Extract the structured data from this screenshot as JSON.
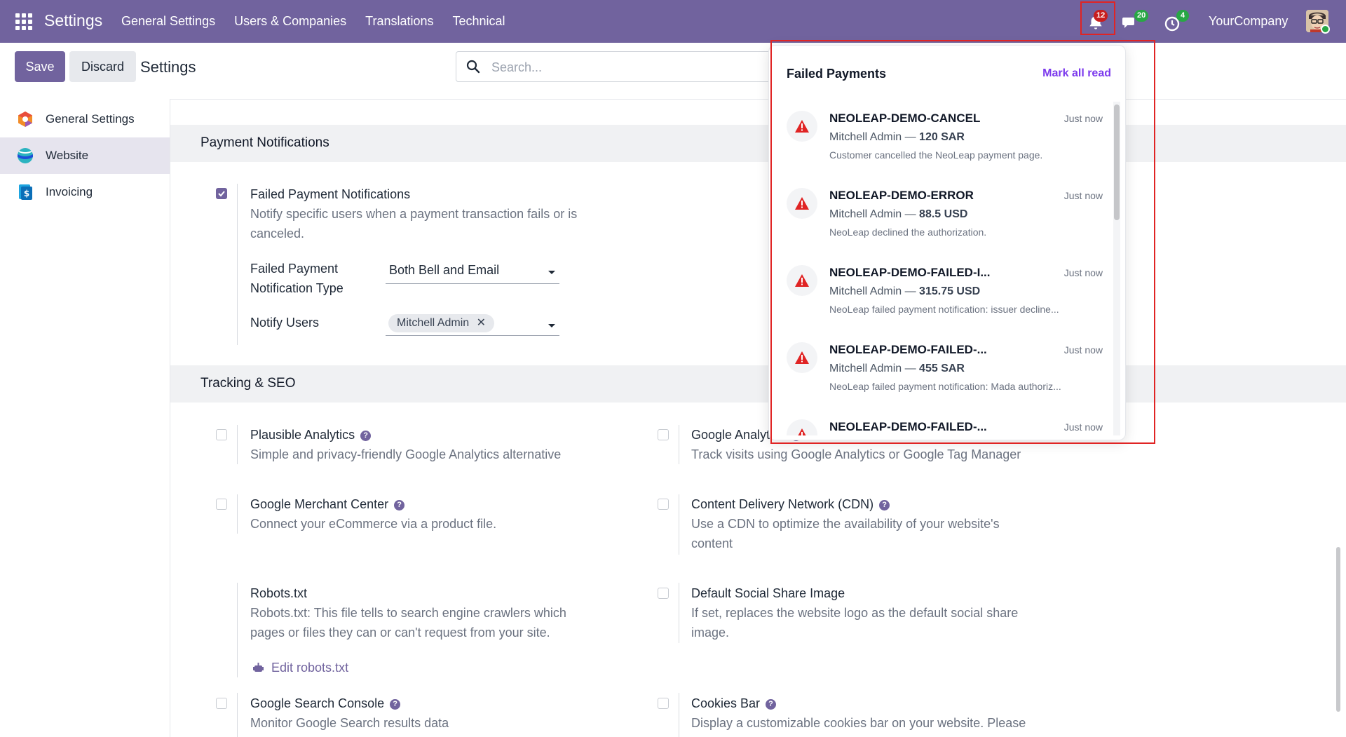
{
  "navbar": {
    "brand": "Settings",
    "menu": [
      "General Settings",
      "Users & Companies",
      "Translations",
      "Technical"
    ],
    "notifications_count": "12",
    "messages_count": "20",
    "activities_count": "4",
    "company": "YourCompany",
    "accent_color": "#71639e"
  },
  "control_panel": {
    "save_label": "Save",
    "discard_label": "Discard",
    "title": "Settings",
    "search_placeholder": "Search..."
  },
  "sidebar": {
    "items": [
      {
        "label": "General Settings",
        "icon": "odoo-settings-icon",
        "active": false
      },
      {
        "label": "Website",
        "icon": "website-app-icon",
        "active": true
      },
      {
        "label": "Invoicing",
        "icon": "invoicing-app-icon",
        "active": false
      }
    ]
  },
  "payment_notifications": {
    "heading": "Payment Notifications",
    "failed_title": "Failed Payment Notifications",
    "failed_desc_line1": "Notify specific users when a payment transaction fails or is",
    "failed_desc_line2": "canceled.",
    "type_label_line1": "Failed Payment",
    "type_label_line2": "Notification Type",
    "type_value": "Both Bell and Email",
    "users_label": "Notify Users",
    "users_tag": "Mitchell Admin"
  },
  "tracking_seo": {
    "heading": "Tracking & SEO",
    "settings": [
      {
        "title": "Plausible Analytics",
        "desc": [
          "Simple and privacy-friendly Google Analytics alternative"
        ]
      },
      {
        "title": "Google Analytics",
        "desc": [
          "Track visits using Google Analytics or Google Tag Manager"
        ]
      },
      {
        "title": "Google Merchant Center",
        "desc": [
          "Connect your eCommerce via a product file."
        ]
      },
      {
        "title": "Content Delivery Network (CDN)",
        "desc": [
          "Use a CDN to optimize the availability of your website's",
          "content"
        ]
      },
      {
        "title": "Robots.txt",
        "desc": [
          "Robots.txt: This file tells to search engine crawlers which",
          "pages or files they can or can't request from your site."
        ],
        "link": "Edit robots.txt"
      },
      {
        "title": "Default Social Share Image",
        "desc": [
          "If set, replaces the website logo as the default social share",
          "image."
        ]
      },
      {
        "title": "Google Search Console",
        "desc": [
          "Monitor Google Search results data"
        ]
      },
      {
        "title": "Cookies Bar",
        "desc": [
          "Display a customizable cookies bar on your website. Please"
        ]
      }
    ]
  },
  "failed_payments_dropdown": {
    "title": "Failed Payments",
    "mark_all_read": "Mark all read",
    "items": [
      {
        "title": "NEOLEAP-DEMO-CANCEL",
        "time": "Just now",
        "user": "Mitchell Admin",
        "amount": "120 SAR",
        "message": "Customer cancelled the NeoLeap payment page."
      },
      {
        "title": "NEOLEAP-DEMO-ERROR",
        "time": "Just now",
        "user": "Mitchell Admin",
        "amount": "88.5 USD",
        "message": "NeoLeap declined the authorization."
      },
      {
        "title": "NEOLEAP-DEMO-FAILED-I...",
        "time": "Just now",
        "user": "Mitchell Admin",
        "amount": "315.75 USD",
        "message": "NeoLeap failed payment notification: issuer decline..."
      },
      {
        "title": "NEOLEAP-DEMO-FAILED-...",
        "time": "Just now",
        "user": "Mitchell Admin",
        "amount": "455 SAR",
        "message": "NeoLeap failed payment notification: Mada authoriz..."
      },
      {
        "title": "NEOLEAP-DEMO-FAILED-...",
        "time": "Just now",
        "user": "",
        "amount": "",
        "message": ""
      }
    ],
    "warning_color": "#e02424"
  }
}
